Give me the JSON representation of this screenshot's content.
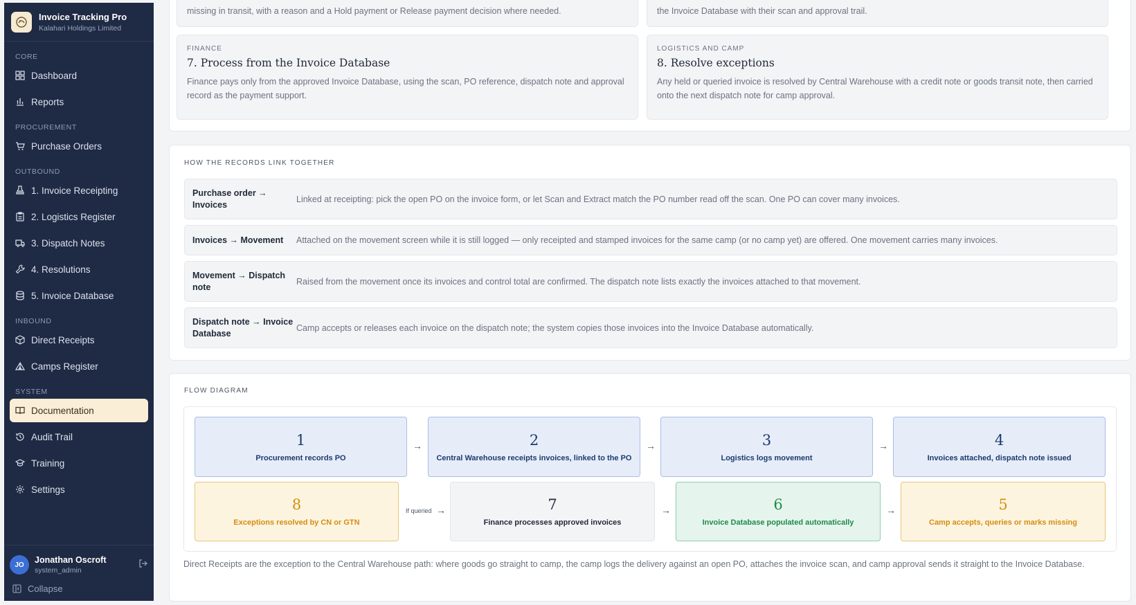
{
  "brand": {
    "title": "Invoice Tracking Pro",
    "subtitle": "Kalahari Holdings Limited"
  },
  "nav": {
    "sections": {
      "core": "CORE",
      "procurement": "PROCUREMENT",
      "outbound": "OUTBOUND",
      "inbound": "INBOUND",
      "system": "SYSTEM"
    },
    "items": {
      "dashboard": "Dashboard",
      "reports": "Reports",
      "purchase_orders": "Purchase Orders",
      "invoice_receipting": "1. Invoice Receipting",
      "logistics_register": "2. Logistics Register",
      "dispatch_notes": "3. Dispatch Notes",
      "resolutions": "4. Resolutions",
      "invoice_database": "5. Invoice Database",
      "direct_receipts": "Direct Receipts",
      "camps_register": "Camps Register",
      "documentation": "Documentation",
      "audit_trail": "Audit Trail",
      "training": "Training",
      "settings": "Settings"
    }
  },
  "user": {
    "initials": "JO",
    "name": "Jonathan Oscroft",
    "role": "system_admin",
    "collapse_label": "Collapse"
  },
  "steps": {
    "cut_left": "missing in transit, with a reason and a Hold payment or Release payment decision where needed.",
    "cut_right": "the Invoice Database with their scan and approval trail.",
    "step7": {
      "category": "FINANCE",
      "title": "7. Process from the Invoice Database",
      "description": "Finance pays only from the approved Invoice Database, using the scan, PO reference, dispatch note and approval record as the payment support."
    },
    "step8": {
      "category": "LOGISTICS AND CAMP",
      "title": "8. Resolve exceptions",
      "description": "Any held or queried invoice is resolved by Central Warehouse with a credit note or goods transit note, then carried onto the next dispatch note for camp approval."
    }
  },
  "links": {
    "heading": "HOW THE RECORDS LINK TOGETHER",
    "rows": [
      {
        "from": "Purchase order → Invoices",
        "description": "Linked at receipting: pick the open PO on the invoice form, or let Scan and Extract match the PO number read off the scan. One PO can cover many invoices."
      },
      {
        "from": "Invoices → Movement",
        "description": "Attached on the movement screen while it is still logged — only receipted and stamped invoices for the same camp (or no camp yet) are offered. One movement carries many invoices."
      },
      {
        "from": "Movement → Dispatch note",
        "description": "Raised from the movement once its invoices and control total are confirmed. The dispatch note lists exactly the invoices attached to that movement."
      },
      {
        "from": "Dispatch note → Invoice Database",
        "description": "Camp accepts or releases each invoice on the dispatch note; the system copies those invoices into the Invoice Database automatically."
      }
    ]
  },
  "flow": {
    "heading": "FLOW DIAGRAM",
    "arrow": "→",
    "if_queried": "If queried",
    "nodes": {
      "n1": {
        "num": "1",
        "label": "Procurement records PO"
      },
      "n2": {
        "num": "2",
        "label": "Central Warehouse receipts invoices, linked to the PO"
      },
      "n3": {
        "num": "3",
        "label": "Logistics logs movement"
      },
      "n4": {
        "num": "4",
        "label": "Invoices attached, dispatch note issued"
      },
      "n5": {
        "num": "5",
        "label": "Camp accepts, queries or marks missing"
      },
      "n6": {
        "num": "6",
        "label": "Invoice Database populated automatically"
      },
      "n7": {
        "num": "7",
        "label": "Finance processes approved invoices"
      },
      "n8": {
        "num": "8",
        "label": "Exceptions resolved by CN or GTN"
      }
    },
    "note": "Direct Receipts are the exception to the Central Warehouse path: where goods go straight to camp, the camp logs the delivery against an open PO, attaches the invoice scan, and camp approval sends it straight to the Invoice Database."
  },
  "colors": {
    "sidebar": "#1f2a44",
    "active_nav": "#fbeed6",
    "blue_node": "#e6edf9",
    "amber_node": "#fdf4e0",
    "green_node": "#e5f4ec"
  }
}
